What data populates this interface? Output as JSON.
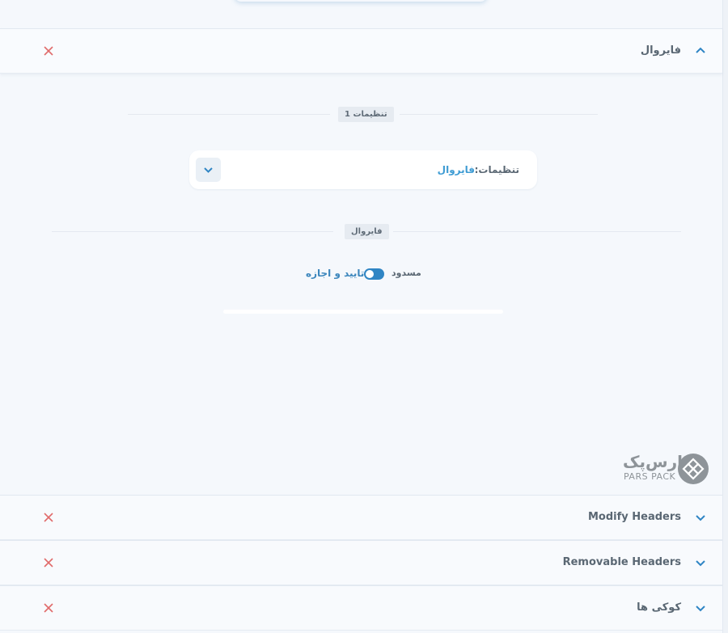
{
  "sections": [
    {
      "title": "فایروال",
      "expanded": true
    },
    {
      "title": "Modify Headers",
      "expanded": false
    },
    {
      "title": "Removable Headers",
      "expanded": false
    },
    {
      "title": "کوکی ها",
      "expanded": false
    }
  ],
  "settings_separator": "تنظیمات 1",
  "settings_select": {
    "label": "تنظیمات:",
    "value": "فایروال"
  },
  "firewall_separator": "فایروال",
  "toggle": {
    "off_label": "مسدود",
    "on_label": "تایید و اجازه",
    "state": "on"
  },
  "logo": {
    "fa": "پارس‌پک",
    "en": "PARS PACK"
  },
  "colors": {
    "accent": "#2f85c4",
    "close": "#e06a6a",
    "text": "#5a6773"
  }
}
